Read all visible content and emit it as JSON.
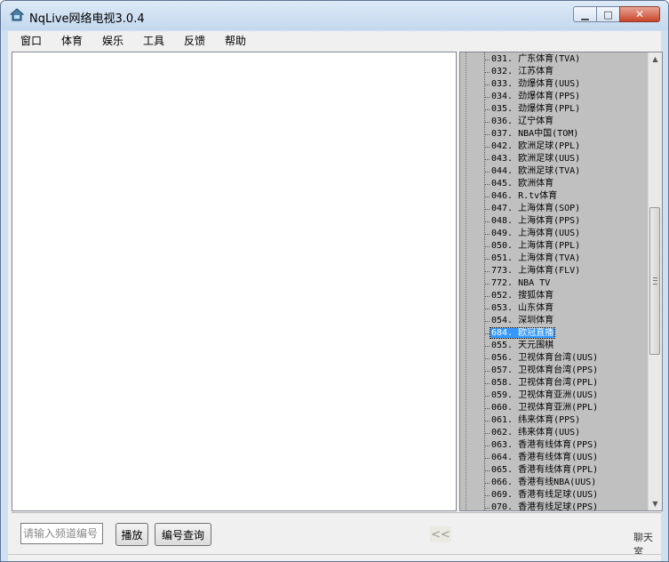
{
  "window": {
    "title": "NqLive网络电视3.0.4"
  },
  "menu": [
    "窗口",
    "体育",
    "娱乐",
    "工具",
    "反馈",
    "帮助"
  ],
  "channels": [
    "031. 广东体育(TVA)",
    "032. 江苏体育",
    "033. 劲爆体育(UUS)",
    "034. 劲爆体育(PPS)",
    "035. 劲爆体育(PPL)",
    "036. 辽宁体育",
    "037. NBA中国(TOM)",
    "042. 欧洲足球(PPL)",
    "043. 欧洲足球(UUS)",
    "044. 欧洲足球(TVA)",
    "045. 欧洲体育",
    "046. R.tv体育",
    "047. 上海体育(SOP)",
    "048. 上海体育(PPS)",
    "049. 上海体育(UUS)",
    "050. 上海体育(PPL)",
    "051. 上海体育(TVA)",
    "773. 上海体育(FLV)",
    "772. NBA TV",
    "052. 搜狐体育",
    "053. 山东体育",
    "054. 深圳体育",
    "684. 欧冠直播",
    "055. 天元围棋",
    "056. 卫视体育台湾(UUS)",
    "057. 卫视体育台湾(PPS)",
    "058. 卫视体育台湾(PPL)",
    "059. 卫视体育亚洲(UUS)",
    "060. 卫视体育亚洲(PPL)",
    "061. 纬来体育(PPS)",
    "062. 纬来体育(UUS)",
    "063. 香港有线体育(PPS)",
    "064. 香港有线体育(UUS)",
    "065. 香港有线体育(PPL)",
    "066. 香港有线NBA(UUS)",
    "069. 香港有线足球(UUS)",
    "070. 香港有线足球(PPS)"
  ],
  "selected_channel_index": 22,
  "bottom": {
    "input_placeholder": "请输入频道编号",
    "play_label": "播放",
    "query_label": "编号查询",
    "collapse_label": "<<",
    "right_label": "聊天室"
  },
  "colors": {
    "selection": "#3399ff",
    "panel_bg": "#c0c0c0",
    "title_bg": "#cfe0f3"
  }
}
